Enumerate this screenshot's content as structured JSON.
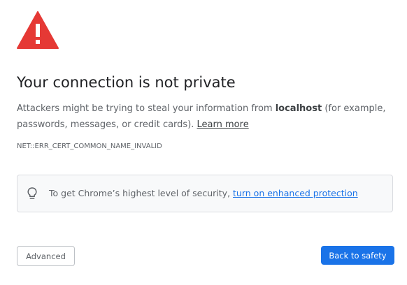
{
  "interstitial": {
    "icon": "warning-triangle-icon",
    "title": "Your connection is not private",
    "description": {
      "prefix": "Attackers might be trying to steal your information from ",
      "host": "localhost",
      "suffix": " (for example, passwords, messages, or credit cards). ",
      "learn_more": "Learn more"
    },
    "error_code": "NET::ERR_CERT_COMMON_NAME_INVALID",
    "security_tip": {
      "icon": "lightbulb-icon",
      "text": "To get Chrome’s highest level of security, ",
      "link": "turn on enhanced protection"
    },
    "buttons": {
      "advanced": "Advanced",
      "back_to_safety": "Back to safety"
    }
  },
  "colors": {
    "warning_red": "#e53935",
    "primary_blue": "#1a73e8",
    "text_dark": "#202124",
    "text_muted": "#5f6368",
    "box_background": "#f8f9fa",
    "border": "#dadce0"
  }
}
